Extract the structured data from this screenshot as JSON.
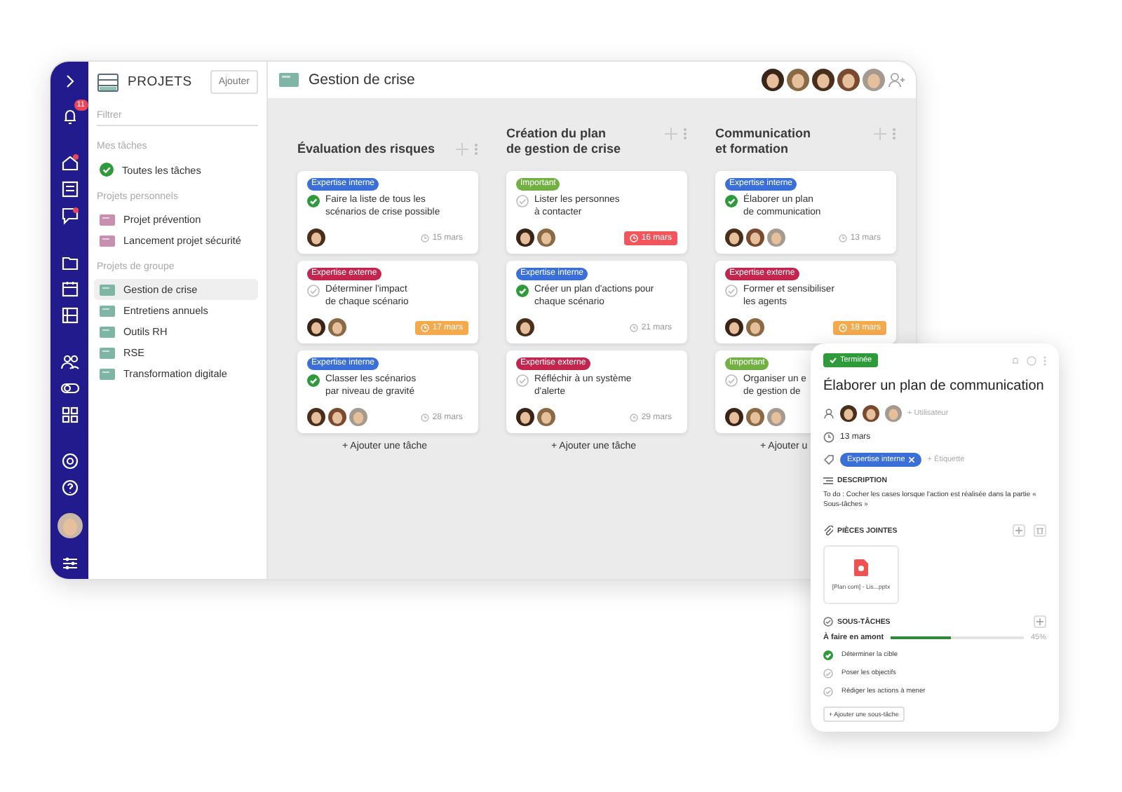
{
  "rail": {
    "notification_count": "11"
  },
  "sidebar": {
    "title": "PROJETS",
    "add_button": "Ajouter",
    "filter": {
      "placeholder": "Filtrer"
    },
    "sections": [
      {
        "heading": "Mes tâches",
        "items": [
          {
            "label": "Toutes les tâches",
            "kind": "all",
            "selected": false
          }
        ]
      },
      {
        "heading": "Projets personnels",
        "items": [
          {
            "label": "Projet prévention",
            "kind": "personal",
            "selected": false
          },
          {
            "label": "Lancement projet sécurité",
            "kind": "personal",
            "selected": false
          }
        ]
      },
      {
        "heading": "Projets de groupe",
        "items": [
          {
            "label": "Gestion de crise",
            "kind": "group",
            "selected": true
          },
          {
            "label": "Entretiens annuels",
            "kind": "group",
            "selected": false
          },
          {
            "label": "Outils RH",
            "kind": "group",
            "selected": false
          },
          {
            "label": "RSE",
            "kind": "group",
            "selected": false
          },
          {
            "label": "Transformation digitale",
            "kind": "group",
            "selected": false
          }
        ]
      }
    ]
  },
  "board": {
    "title": "Gestion de crise",
    "members": [
      {
        "color": "#3a2418"
      },
      {
        "color": "#8a6a44"
      },
      {
        "color": "#4a2e1c"
      },
      {
        "color": "#7a4a30"
      },
      {
        "color": "#a59a90"
      }
    ],
    "columns": [
      {
        "title_lines": [
          "Évaluation des risques"
        ],
        "add_task": "+ Ajouter une tâche",
        "cards": [
          {
            "tag": {
              "label": "Expertise interne",
              "color": "#3a6fd8"
            },
            "done": true,
            "title_lines": [
              "Faire la liste de tous les",
              "scénarios de crise possible"
            ],
            "avatars": [
              {
                "color": "#4a2e1c"
              }
            ],
            "due": {
              "date": "15 mars",
              "overdue": false,
              "due_soon": false
            }
          },
          {
            "tag": {
              "label": "Expertise externe",
              "color": "#c2264f"
            },
            "done": false,
            "title_lines": [
              "Déterminer l'impact",
              "de chaque scénario"
            ],
            "avatars": [
              {
                "color": "#3a2418"
              },
              {
                "color": "#8a6a44"
              }
            ],
            "due": {
              "date": "17 mars",
              "overdue": false,
              "due_soon": true
            }
          },
          {
            "tag": {
              "label": "Expertise interne",
              "color": "#3a6fd8"
            },
            "done": true,
            "title_lines": [
              "Classer les scénarios",
              "par niveau de gravité"
            ],
            "avatars": [
              {
                "color": "#4a2e1c"
              },
              {
                "color": "#7a4a30"
              },
              {
                "color": "#a59a90"
              }
            ],
            "due": {
              "date": "28 mars",
              "overdue": false,
              "due_soon": false
            }
          }
        ]
      },
      {
        "title_lines": [
          "Création du plan",
          "de gestion de crise"
        ],
        "add_task": "+ Ajouter une tâche",
        "cards": [
          {
            "tag": {
              "label": "Important",
              "color": "#72b043"
            },
            "done": false,
            "title_lines": [
              "Lister les personnes",
              "à contacter"
            ],
            "avatars": [
              {
                "color": "#3a2418"
              },
              {
                "color": "#8a6a44"
              }
            ],
            "due": {
              "date": "16 mars",
              "overdue": true,
              "due_soon": false
            }
          },
          {
            "tag": {
              "label": "Expertise interne",
              "color": "#3a6fd8"
            },
            "done": true,
            "title_lines": [
              "Créer un plan d'actions pour",
              "chaque scénario"
            ],
            "avatars": [
              {
                "color": "#4a2e1c"
              }
            ],
            "due": {
              "date": "21 mars",
              "overdue": false,
              "due_soon": false
            }
          },
          {
            "tag": {
              "label": "Expertise externe",
              "color": "#c2264f"
            },
            "done": false,
            "title_lines": [
              "Réfléchir à un système",
              "d'alerte"
            ],
            "avatars": [
              {
                "color": "#3a2418"
              },
              {
                "color": "#8a6a44"
              }
            ],
            "due": {
              "date": "29 mars",
              "overdue": false,
              "due_soon": false
            }
          }
        ]
      },
      {
        "title_lines": [
          "Communication",
          "et formation"
        ],
        "add_task": "+ Ajouter u",
        "cards": [
          {
            "tag": {
              "label": "Expertise interne",
              "color": "#3a6fd8"
            },
            "done": true,
            "title_lines": [
              "Élaborer un plan",
              "de communication"
            ],
            "avatars": [
              {
                "color": "#4a2e1c"
              },
              {
                "color": "#7a4a30"
              },
              {
                "color": "#a59a90"
              }
            ],
            "due": {
              "date": "13 mars",
              "overdue": false,
              "due_soon": false
            }
          },
          {
            "tag": {
              "label": "Expertise externe",
              "color": "#c2264f"
            },
            "done": false,
            "title_lines": [
              "Former et sensibiliser",
              "les agents"
            ],
            "avatars": [
              {
                "color": "#3a2418"
              },
              {
                "color": "#8a6a44"
              }
            ],
            "due": {
              "date": "18 mars",
              "overdue": false,
              "due_soon": true
            }
          },
          {
            "tag": {
              "label": "Important",
              "color": "#72b043"
            },
            "done": false,
            "title_lines": [
              "Organiser un e",
              "de gestion de"
            ],
            "avatars": [
              {
                "color": "#3a2418"
              },
              {
                "color": "#8a6a44"
              },
              {
                "color": "#a59a90"
              }
            ]
          }
        ]
      }
    ]
  },
  "task_panel": {
    "status": "Terminée",
    "title": "Élaborer un plan de communication",
    "assignees": [
      {
        "color": "#4a2e1c"
      },
      {
        "color": "#7a4a30"
      },
      {
        "color": "#a59a90"
      }
    ],
    "add_user": "+ Utilisateur",
    "date": "13 mars",
    "tags": [
      {
        "label": "Expertise interne",
        "color": "#3a6fd8"
      }
    ],
    "add_tag": "+ Étiquette",
    "description_heading": "DESCRIPTION",
    "description": "To do : Cocher les cases lorsque l'action est réalisée dans la partie « Sous-tâches »",
    "attachments_heading": "PIÈCES JOINTES",
    "attachments": [
      {
        "name": "[Plan com] - Lis...pptx"
      }
    ],
    "subtasks_heading": "SOUS-TÂCHES",
    "progress": {
      "label": "À faire en amont",
      "level": 0.45,
      "reading": "45%"
    },
    "subtasks": [
      {
        "label": "Déterminer la cible",
        "checked": true
      },
      {
        "label": "Poser les objectifs",
        "checked": false
      },
      {
        "label": "Rédiger les actions à mener",
        "checked": false
      }
    ],
    "add_subtask": "+ Ajouter une sous-tâche"
  }
}
